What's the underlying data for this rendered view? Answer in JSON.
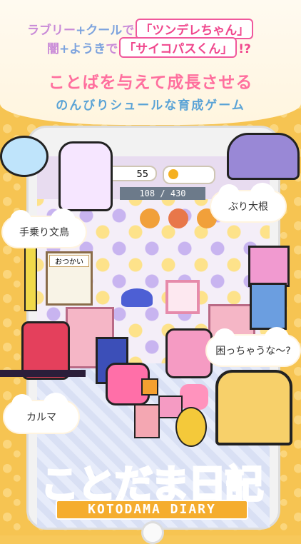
{
  "headline": {
    "line1_a": "ラブリー",
    "line1_b": "+クール",
    "line1_c": "で",
    "line1_tag": "「ツンデレちゃん」",
    "line2_a": "闇",
    "line2_b": "+ようき",
    "line2_c": "で",
    "line2_tag": "「サイコパスくん」",
    "line2_end": "!?"
  },
  "tagline": {
    "line1": "ことばを与えて成長させる",
    "line2": "のんびりシュールな育成ゲーム"
  },
  "game_hud": {
    "coins": "55",
    "exp_current": "108",
    "exp_separator": "/",
    "exp_max": "430"
  },
  "game_ui": {
    "sign_label": "おつかい"
  },
  "bubbles": {
    "tenori": "手乗り文鳥",
    "buri": "ぶり大根",
    "komaccha": "困っちゃうな〜?",
    "karuma": "カルマ"
  },
  "logo": {
    "title": "ことだま日記",
    "subtitle": "KOTODAMA DIARY"
  },
  "colors": {
    "background": "#f6c452",
    "pink_accent": "#f0478d",
    "blue_accent": "#5aa3d6",
    "logo_pink": "#ff7fb4",
    "logo_orange": "#f5ad2e"
  }
}
